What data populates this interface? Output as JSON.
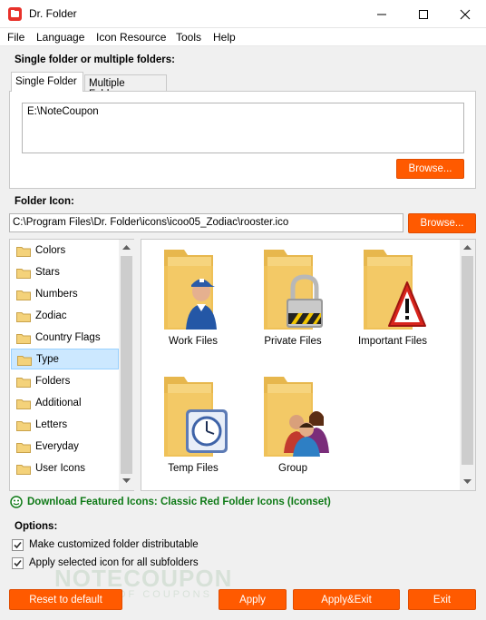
{
  "window": {
    "title": "Dr. Folder",
    "app_icon": "drfolder-app-icon"
  },
  "menu": [
    "File",
    "Language",
    "Icon Resource",
    "Tools",
    "Help"
  ],
  "folders_section": {
    "label": "Single folder or multiple folders:",
    "tabs": [
      "Single Folder",
      "Multiple Folders"
    ],
    "active_tab": "Single Folder",
    "folder_path": "E:\\NoteCoupon",
    "browse_label": "Browse..."
  },
  "icon_section": {
    "label": "Folder Icon:",
    "path": "C:\\Program Files\\Dr. Folder\\icons\\icoo05_Zodiac\\rooster.ico",
    "browse_label": "Browse..."
  },
  "categories": [
    "Colors",
    "Stars",
    "Numbers",
    "Zodiac",
    "Country Flags",
    "Type",
    "Folders",
    "Additional",
    "Letters",
    "Everyday",
    "User Icons"
  ],
  "selected_category": "Type",
  "icons": [
    {
      "name": "Work Files",
      "icon": "folder-worker-icon"
    },
    {
      "name": "Private Files",
      "icon": "folder-padlock-icon"
    },
    {
      "name": "Important Files",
      "icon": "folder-warning-icon"
    },
    {
      "name": "Temp Files",
      "icon": "folder-clock-icon"
    },
    {
      "name": "Group",
      "icon": "folder-people-icon"
    }
  ],
  "download_link": "Download Featured Icons: Classic Red Folder Icons (Iconset)",
  "options": {
    "label": "Options:",
    "items": [
      {
        "label": "Make customized folder distributable",
        "checked": true
      },
      {
        "label": "Apply selected icon for all subfolders",
        "checked": true
      }
    ]
  },
  "watermark": {
    "line1": "NOTECOUPON",
    "line2": "OF COUPONS"
  },
  "buttons": {
    "reset": "Reset to default",
    "apply": "Apply",
    "apply_exit": "Apply&Exit",
    "exit": "Exit"
  },
  "colors": {
    "accent": "#ff5a00",
    "link": "#0f7a17",
    "folder": "#f4c860",
    "selection": "#cce8ff"
  }
}
